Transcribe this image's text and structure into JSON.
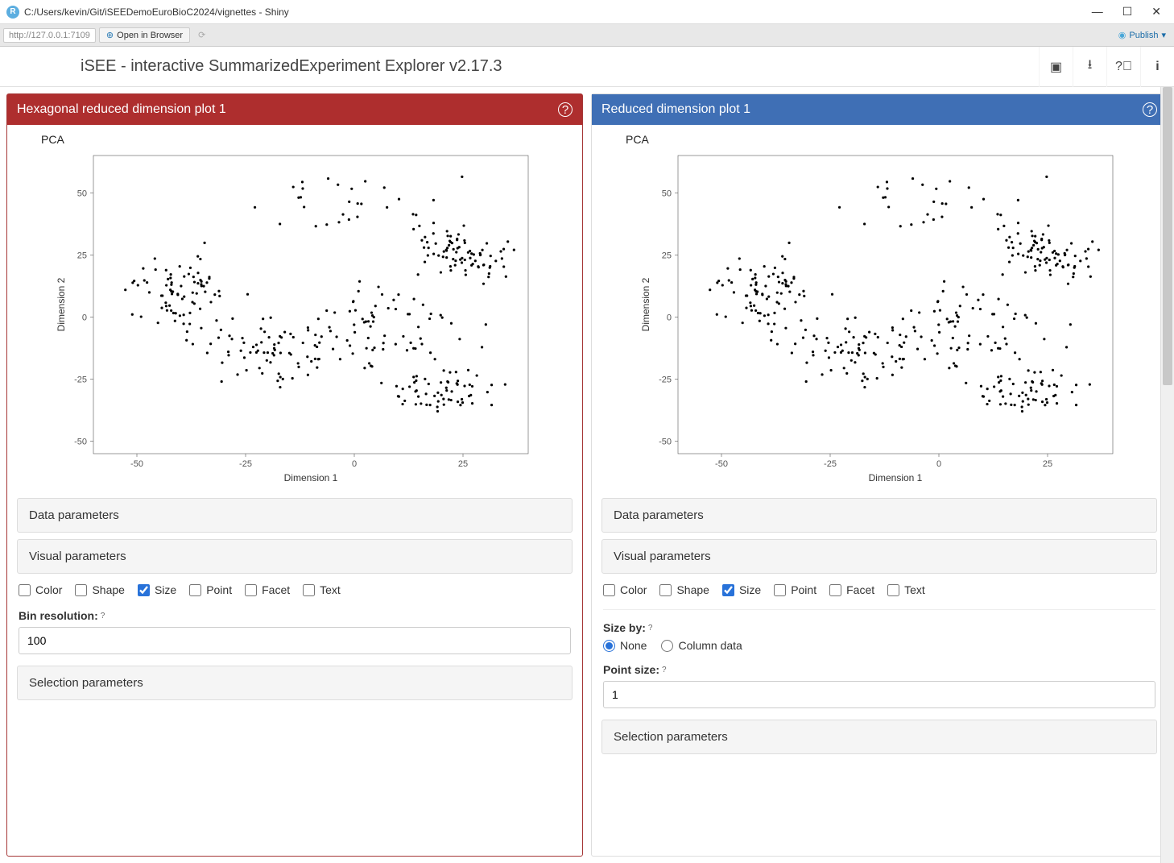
{
  "window_title": "C:/Users/kevin/Git/iSEEDemoEuroBioC2024/vignettes - Shiny",
  "url": "http://127.0.0.1:7109",
  "open_browser": "Open in Browser",
  "publish": "Publish",
  "app_title": "iSEE - interactive SummarizedExperiment Explorer v2.17.3",
  "panel_left": {
    "title": "Hexagonal reduced dimension plot 1",
    "plot_title": "PCA",
    "data_params": "Data parameters",
    "visual_params": "Visual parameters",
    "selection_params": "Selection parameters",
    "checks": {
      "color": "Color",
      "shape": "Shape",
      "size": "Size",
      "point": "Point",
      "facet": "Facet",
      "text": "Text"
    },
    "bin_label": "Bin resolution:",
    "bin_value": "100"
  },
  "panel_right": {
    "title": "Reduced dimension plot 1",
    "plot_title": "PCA",
    "data_params": "Data parameters",
    "visual_params": "Visual parameters",
    "selection_params": "Selection parameters",
    "checks": {
      "color": "Color",
      "shape": "Shape",
      "size": "Size",
      "point": "Point",
      "facet": "Facet",
      "text": "Text"
    },
    "size_by": "Size by:",
    "size_none": "None",
    "size_coldata": "Column data",
    "point_size": "Point size:",
    "point_size_value": "1"
  },
  "chart_data": [
    {
      "type": "scatter",
      "title": "PCA",
      "xlabel": "Dimension 1",
      "ylabel": "Dimension 2",
      "xlim": [
        -60,
        40
      ],
      "ylim": [
        -55,
        65
      ],
      "xticks": [
        -50,
        -25,
        0,
        25
      ],
      "yticks": [
        -50,
        -25,
        0,
        25,
        50
      ]
    },
    {
      "type": "scatter",
      "title": "PCA",
      "xlabel": "Dimension 1",
      "ylabel": "Dimension 2",
      "xlim": [
        -60,
        40
      ],
      "ylim": [
        -55,
        65
      ],
      "xticks": [
        -50,
        -25,
        0,
        25
      ],
      "yticks": [
        -50,
        -25,
        0,
        25,
        50
      ]
    }
  ]
}
